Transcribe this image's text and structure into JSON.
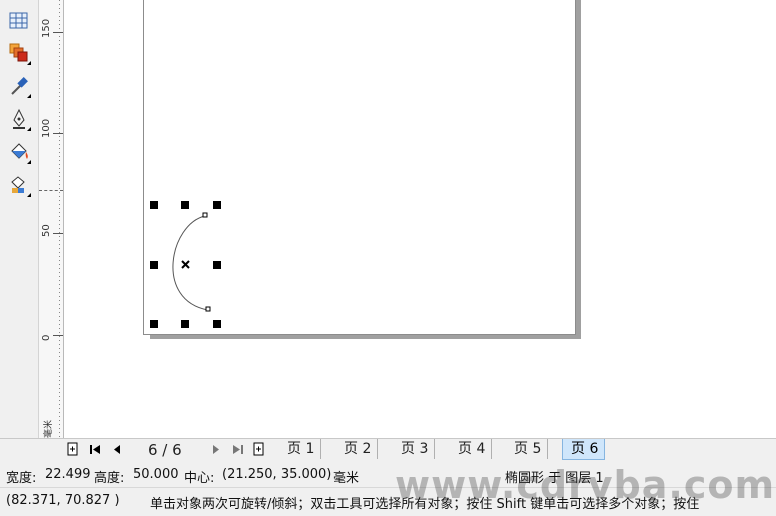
{
  "toolbox": {
    "tools": [
      {
        "name": "table-tool",
        "icon": "table-icon"
      },
      {
        "name": "blend-tool",
        "icon": "interactive-blend-icon"
      },
      {
        "name": "eyedropper-tool",
        "icon": "eyedropper-icon"
      },
      {
        "name": "outline-pen-tool",
        "icon": "pen-nib-icon"
      },
      {
        "name": "fill-tool",
        "icon": "paint-bucket-icon"
      },
      {
        "name": "interactive-fill-tool",
        "icon": "interactive-fill-icon"
      }
    ]
  },
  "ruler": {
    "labels": [
      "150",
      "100",
      "50",
      "0"
    ],
    "unit_label": "毫米"
  },
  "navigator": {
    "page_count": "6 / 6",
    "tabs": [
      "页 1",
      "页 2",
      "页 3",
      "页 4",
      "页 5",
      "页 6"
    ],
    "active_tab": "页 6"
  },
  "status": {
    "width_label": "宽度:",
    "width_value": "22.499",
    "height_label": "高度:",
    "height_value": "50.000",
    "center_label": "中心:",
    "center_value": "(21.250, 35.000)",
    "unit": "毫米",
    "object_info": "椭圆形 于 图层 1",
    "cursor_coords": "(82.371, 70.827 )",
    "hint": "单击对象两次可旋转/倾斜；双击工具可选择所有对象；按住 Shift 键单击可选择多个对象；按住"
  },
  "watermark": "www.cdrvba.com",
  "colors": {
    "active_tab": "#cfe6fb",
    "panel": "#f0f0f0",
    "page_shadow": "#a0a0a0"
  }
}
